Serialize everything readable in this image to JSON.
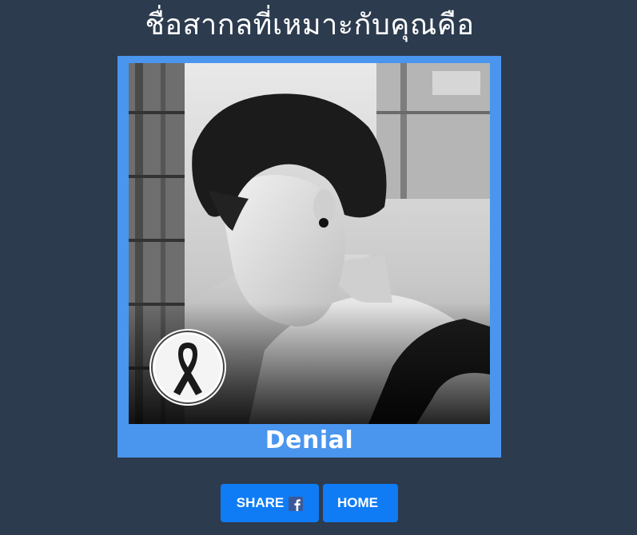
{
  "header": {
    "title": "ชื่อสากลที่เหมาะกับคุณคือ"
  },
  "result": {
    "name": "Denial",
    "photo_icon": "mourning-ribbon-icon"
  },
  "actions": {
    "share_label": "SHARE",
    "share_icon": "facebook-icon",
    "home_label": "HOME"
  },
  "colors": {
    "background": "#2c3b4e",
    "card_frame": "#4a95ee",
    "button": "#0f7cf6",
    "facebook": "#3b5998"
  }
}
